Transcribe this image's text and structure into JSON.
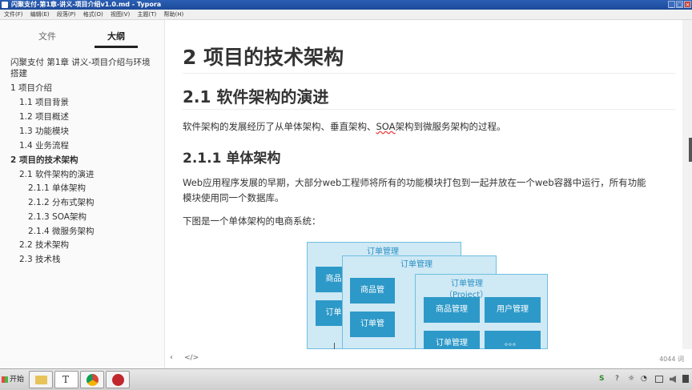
{
  "window": {
    "title": "闪聚支付-第1章-讲义-项目介绍v1.0.md - Typora",
    "minimize": "_",
    "maximize": "□",
    "close": "×"
  },
  "menubar": [
    "文件(F)",
    "编辑(E)",
    "段落(P)",
    "格式(O)",
    "视图(V)",
    "主题(T)",
    "帮助(H)"
  ],
  "sidebar": {
    "tabs": [
      "文件",
      "大纲"
    ],
    "active_tab": "大纲",
    "outline": [
      {
        "label": "闪聚支付 第1章 讲义-项目介绍与环境",
        "level": 0
      },
      {
        "label": "搭建",
        "level": 0
      },
      {
        "label": "1 项目介绍",
        "level": 1
      },
      {
        "label": "1.1 项目背景",
        "level": 2
      },
      {
        "label": "1.2 项目概述",
        "level": 2
      },
      {
        "label": "1.3 功能模块",
        "level": 2
      },
      {
        "label": "1.4 业务流程",
        "level": 2
      },
      {
        "label": "2 项目的技术架构",
        "level": 1,
        "bold": true
      },
      {
        "label": "2.1 软件架构的演进",
        "level": 2
      },
      {
        "label": "2.1.1 单体架构",
        "level": 3
      },
      {
        "label": "2.1.2 分布式架构",
        "level": 3
      },
      {
        "label": "2.1.3 SOA架构",
        "level": 3
      },
      {
        "label": "2.1.4 微服务架构",
        "level": 3
      },
      {
        "label": "2.2 技术架构",
        "level": 2
      },
      {
        "label": "2.3 技术栈",
        "level": 2
      }
    ]
  },
  "content": {
    "h1": "2 项目的技术架构",
    "h2": "2.1 软件架构的演进",
    "p1_a": "软件架构的发展经历了从单体架构、垂直架构、",
    "p1_soa": "SOA",
    "p1_b": "架构到微服务架构的过程。",
    "h3": "2.1.1 单体架构",
    "p2_line1": "Web应用程序发展的早期，大部分web工程师将所有的功能模块打包到一起并放在一个web容器中运行，所有功能",
    "p2_line2": "模块使用同一个数据库。",
    "p3": "下图是一个单体架构的电商系统：",
    "diagram": {
      "box_title": "订单管理",
      "box_subtitle": "（Project）",
      "modules": [
        "商品管理",
        "用户管理",
        "订单管理",
        "。。。"
      ],
      "partial_module_1": "商品",
      "partial_module_2": "订单",
      "partial_module_3": "商品管",
      "partial_module_4": "订单管"
    }
  },
  "statusbar": {
    "toggle_sidebar": "‹",
    "source_mode": "</>",
    "word_count": "4044 词"
  },
  "taskbar": {
    "start": "开始",
    "typora_label": "T",
    "tray_time": "",
    "tray_icons": [
      "S",
      "?",
      "☼",
      "◔"
    ]
  },
  "colors": {
    "diagram_bg": "#cfe9f5",
    "diagram_border": "#6fbfe0",
    "module_bg": "#2d99c8",
    "title_text": "#2a8fc4"
  }
}
